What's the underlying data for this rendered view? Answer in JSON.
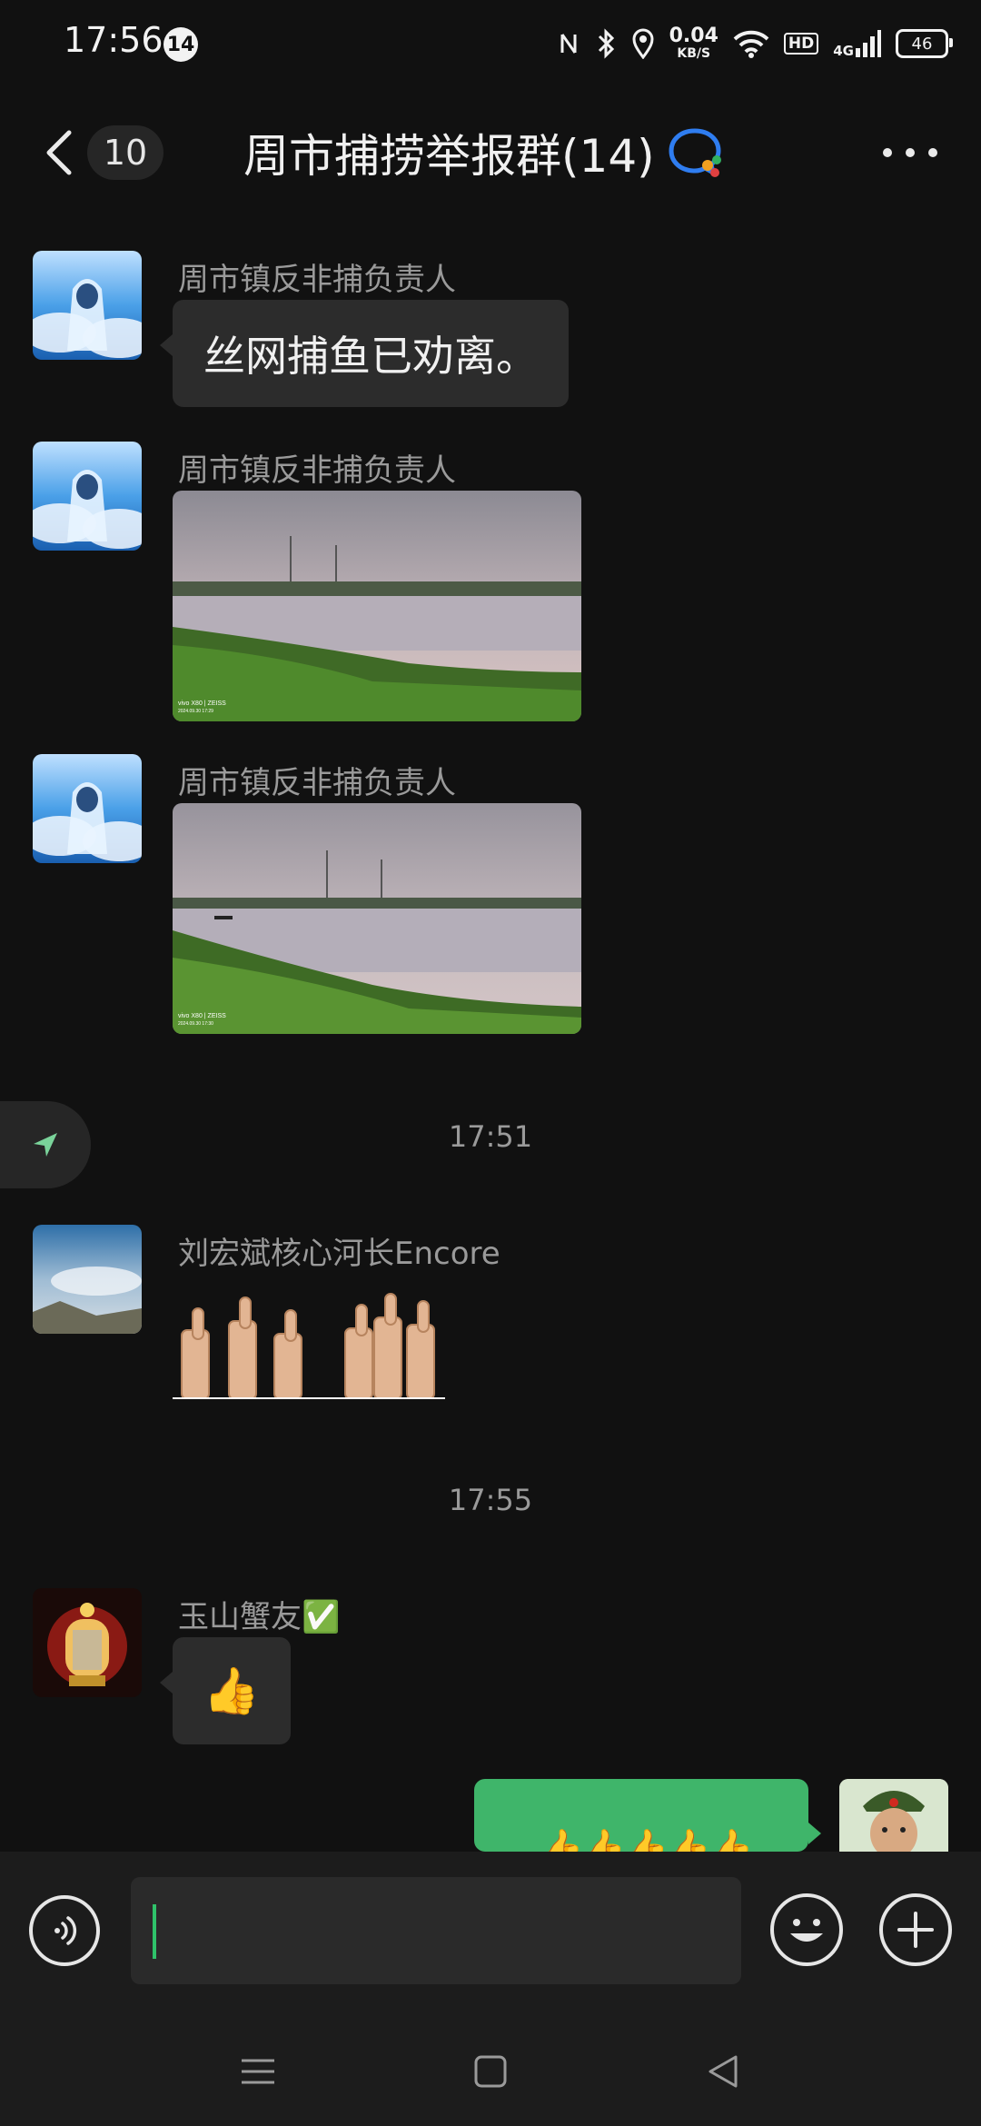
{
  "status_bar": {
    "time": "17:56",
    "notification_count": "14",
    "net_speed_value": "0.04",
    "net_speed_unit": "KB/S",
    "hd_label": "HD",
    "network_label": "4G",
    "battery": "46"
  },
  "header": {
    "unread_count": "10",
    "title": "周市捕捞举报群(14)",
    "icons": [
      "back-icon",
      "group-chat-icon",
      "more-icon"
    ]
  },
  "messages": [
    {
      "sender": "周市镇反非捕负责人",
      "type": "text",
      "text": "丝网捕鱼已劝离。"
    },
    {
      "sender": "周市镇反非捕负责人",
      "type": "image",
      "watermark_line1": "vivo X80 | ZEISS",
      "watermark_line2": "2024.09.30 17:29"
    },
    {
      "sender": "周市镇反非捕负责人",
      "type": "image",
      "watermark_line1": "vivo X80 | ZEISS",
      "watermark_line2": "2024.09.30 17:30"
    },
    {
      "type": "time",
      "text": "17:51"
    },
    {
      "sender": "刘宏斌核心河长Encore",
      "type": "sticker",
      "sticker": "thumbs-up-hands"
    },
    {
      "type": "time",
      "text": "17:55"
    },
    {
      "sender": "玉山蟹友✅",
      "type": "emoji",
      "text": "👍"
    },
    {
      "sender": "me",
      "type": "emoji",
      "text": "👍👍👍👍👍"
    }
  ],
  "input": {
    "value": "",
    "icons": [
      "voice-icon",
      "emoji-icon",
      "plus-icon"
    ]
  },
  "nav": [
    "menu-icon",
    "home-icon",
    "back-triangle-icon"
  ],
  "colors": {
    "background": "#111111",
    "bubble_in": "#2c2c2c",
    "bubble_out": "#3fb56a",
    "accent": "#2fc26a"
  }
}
